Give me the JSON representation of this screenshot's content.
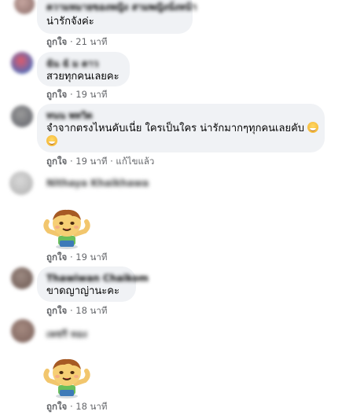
{
  "comments": [
    {
      "author": "ความหมายของหญิง สามพญิงนั่งหน้า",
      "text": "น่ารักจังค่ะ",
      "like": "ถูกใจ",
      "sep": "·",
      "time": "21 นาที"
    },
    {
      "author": "ฉัน ฉั ม ดาว",
      "text": "สวยทุกคนเลยคะ",
      "like": "ถูกใจ",
      "sep": "·",
      "time": "19 นาที"
    },
    {
      "author": "ทนน พทวิด",
      "text_line1": "จำจากตรงไหนคับเนี่ย ใครเป็นใคร น่ารักมากๆทุกคนเลยคับ",
      "like": "ถูกใจ",
      "sep": "·",
      "time": "19 นาที",
      "edited": "แก้ไขแล้ว"
    },
    {
      "author": "Nithaya Khaikhawa",
      "like": "ถูกใจ",
      "sep": "·",
      "time": "19 นาที",
      "sticker": "waving-boy-sticker"
    },
    {
      "author": "Thawiwan Chaikom",
      "text": "ขาดญาญ่านะคะ",
      "like": "ถูกใจ",
      "sep": "·",
      "time": "18 นาที"
    },
    {
      "author": "เพชรี ทอง",
      "like": "ถูกใจ",
      "sep": "·",
      "time": "18 นาที",
      "sticker": "waving-boy-sticker"
    }
  ],
  "colors": {
    "bubble": "#f0f2f5",
    "meta": "#65676b",
    "text": "#050505"
  }
}
